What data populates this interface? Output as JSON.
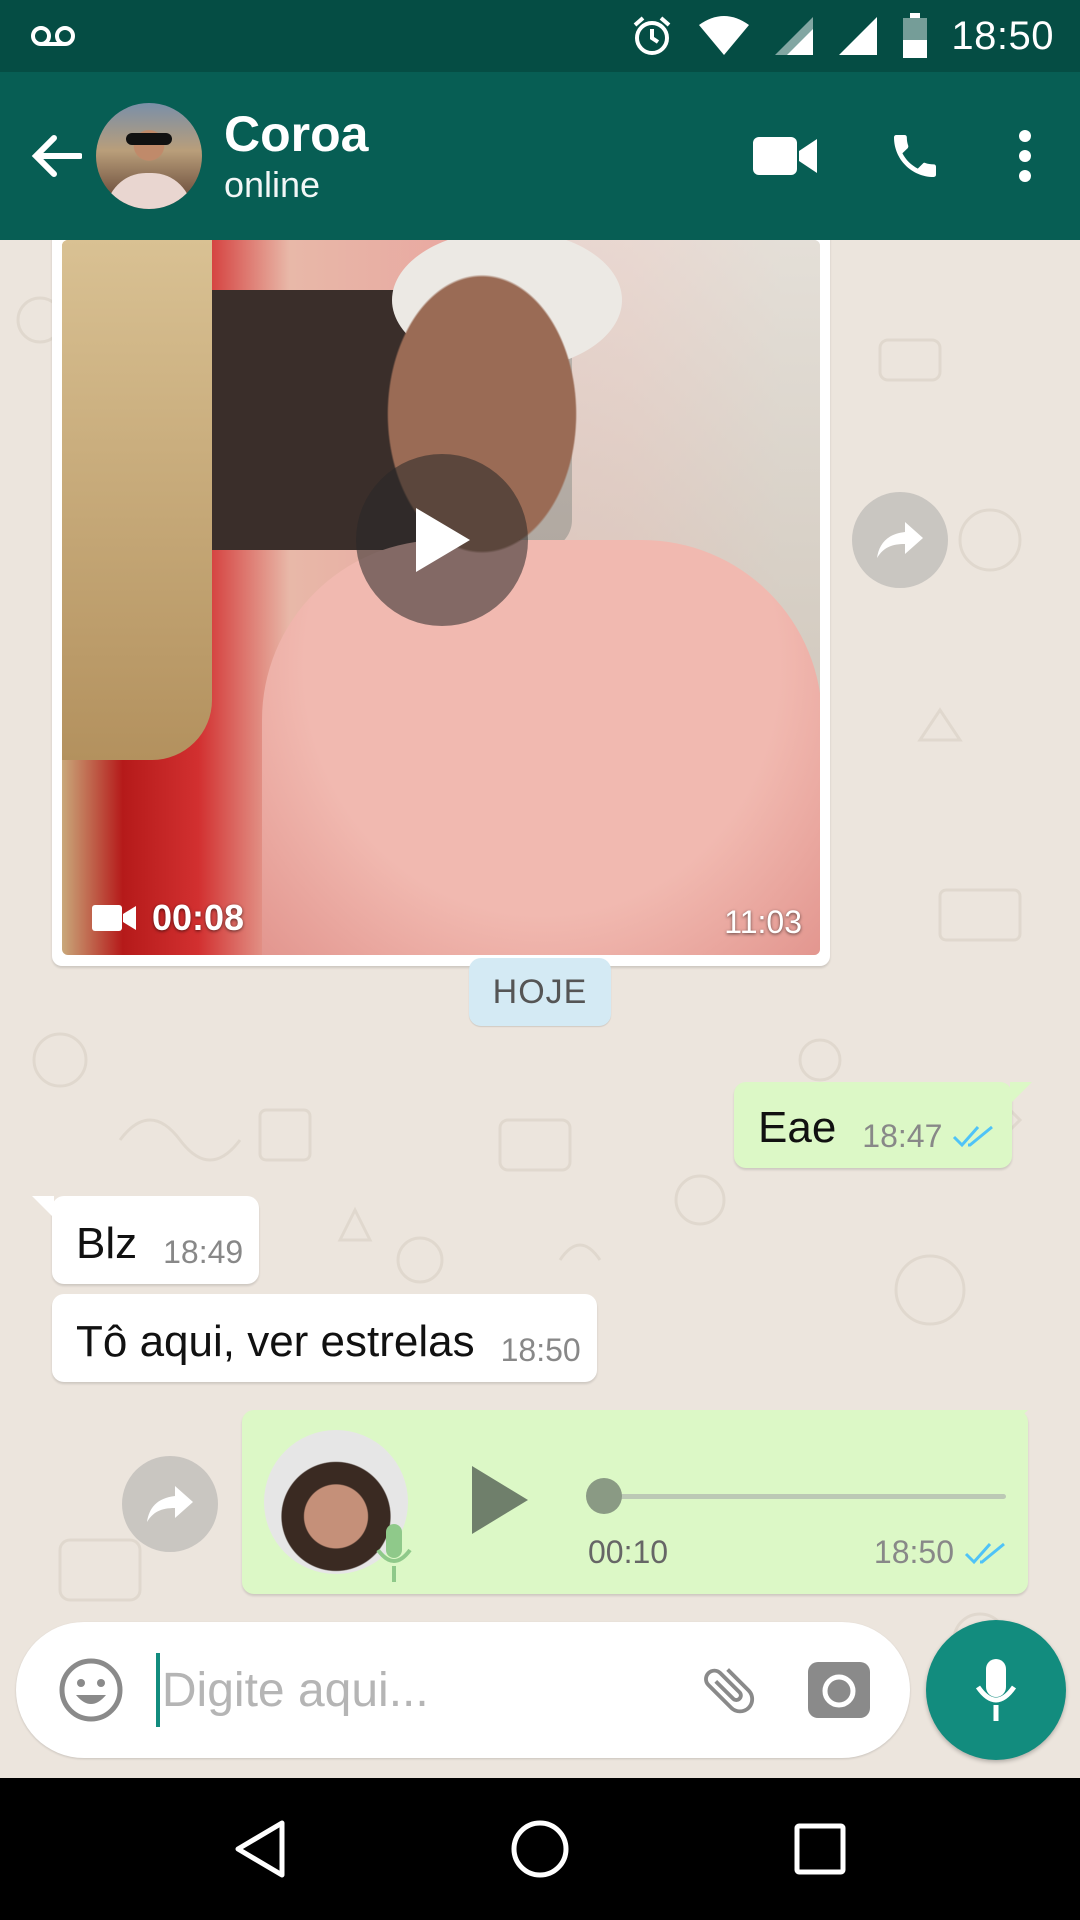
{
  "status_bar": {
    "time": "18:50",
    "icons": [
      "voicemail-icon",
      "alarm-icon",
      "wifi-icon",
      "signal-icon",
      "signal-icon",
      "battery-icon"
    ]
  },
  "header": {
    "contact_name": "Coroa",
    "contact_status": "online",
    "actions": [
      "back-arrow-icon",
      "video-call-icon",
      "phone-icon",
      "more-vert-icon"
    ]
  },
  "chat": {
    "video_message": {
      "duration": "00:08",
      "time": "11:03"
    },
    "date_chip": "HOJE",
    "messages": [
      {
        "direction": "out",
        "text": "Eae",
        "time": "18:47",
        "status": "read"
      },
      {
        "direction": "in",
        "text": "Blz",
        "time": "18:49"
      },
      {
        "direction": "in",
        "text": "Tô aqui, ver estrelas",
        "time": "18:50"
      }
    ],
    "voice_message": {
      "duration": "00:10",
      "time": "18:50",
      "status": "read",
      "progress": 0
    }
  },
  "composer": {
    "placeholder": "Digite aqui...",
    "value": ""
  },
  "colors": {
    "status_bar": "#054d44",
    "header": "#075e54",
    "accent": "#128c7e",
    "outgoing_bubble": "#dcf8c6",
    "incoming_bubble": "#ffffff",
    "read_ticks": "#4fc3f7",
    "chat_bg": "#ece5dd",
    "date_chip": "#d4eaf4"
  },
  "navigation": [
    "back-triangle-icon",
    "home-circle-icon",
    "recents-square-icon"
  ]
}
